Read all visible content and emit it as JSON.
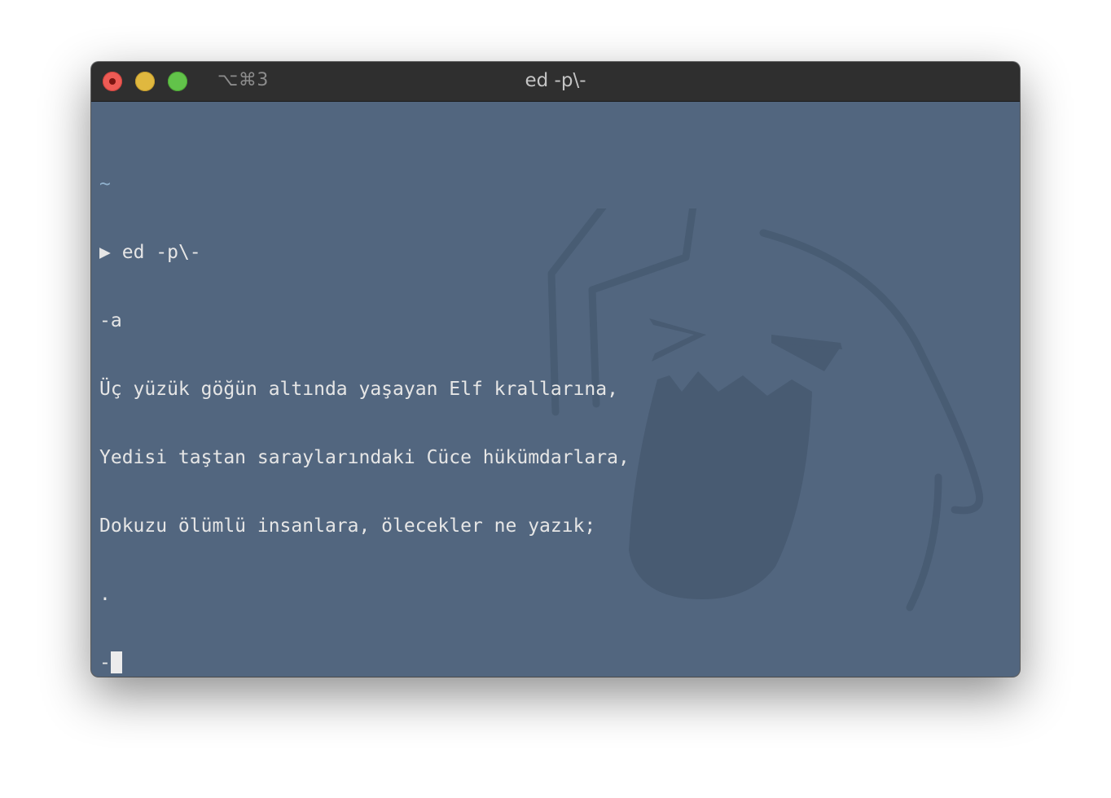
{
  "window": {
    "title": "ed -p\\-",
    "shortcut": "⌥⌘3"
  },
  "terminal": {
    "cwd": "~",
    "prompt_symbol": "▶",
    "command": "ed -p\\-",
    "append_command": "-a",
    "lines": [
      "Üç yüzük göğün altında yaşayan Elf krallarına,",
      "Yedisi taştan saraylarındaki Cüce hükümdarlara,",
      "Dokuzu ölümlü insanlara, ölecekler ne yazık;"
    ],
    "end_input": ".",
    "current_prompt": "-"
  },
  "colors": {
    "terminal_background": "#52667f",
    "titlebar": "#2f2f2f",
    "text": "#e6e6e6",
    "cwd": "#8fb0cc"
  }
}
